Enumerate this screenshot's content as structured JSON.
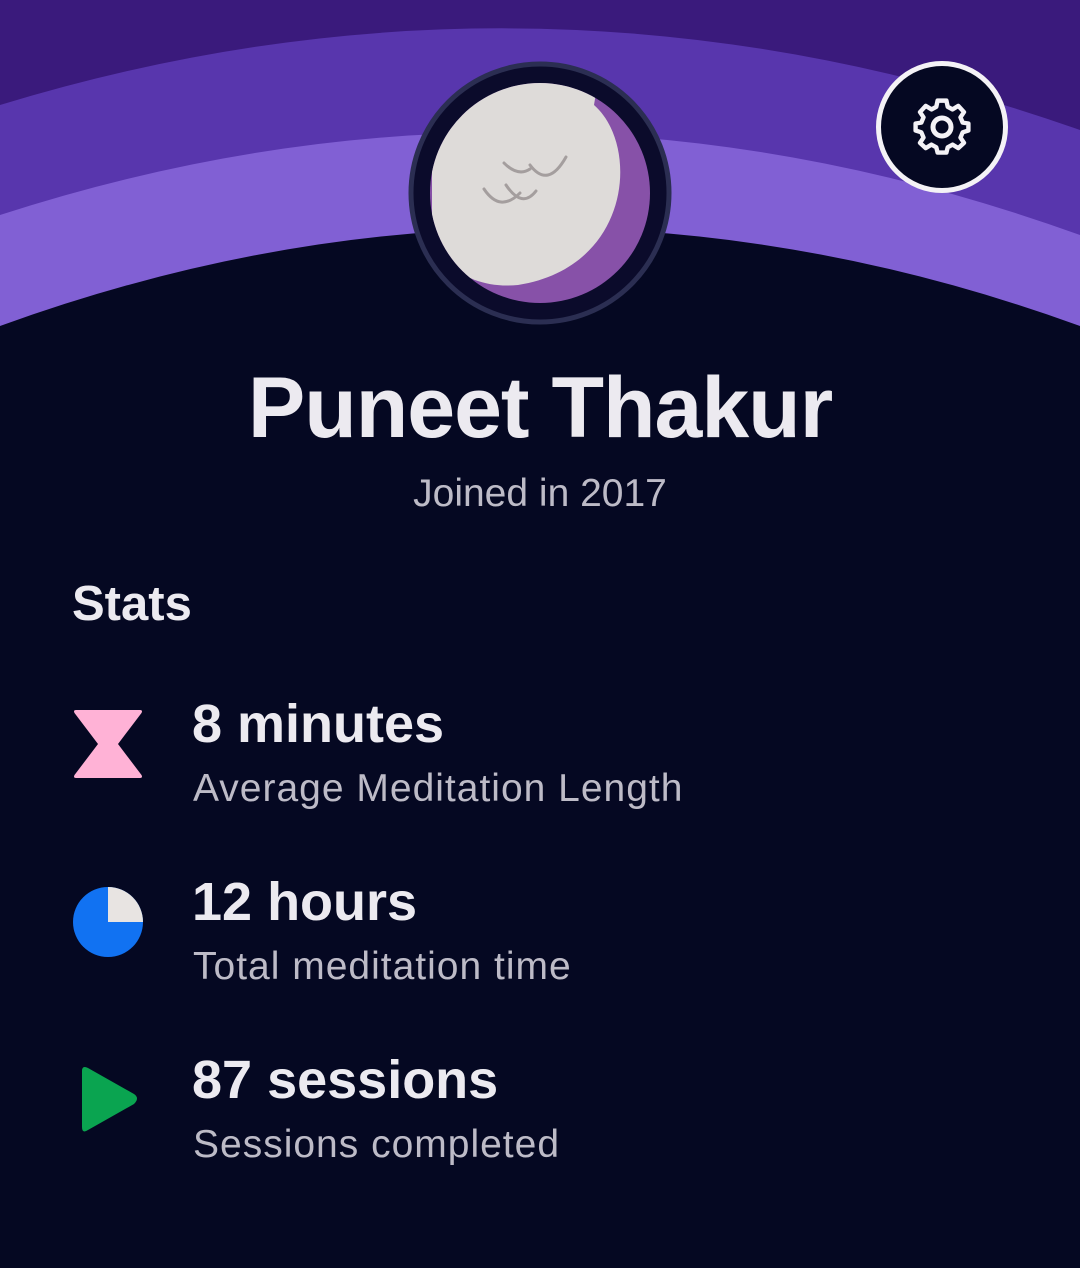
{
  "profile": {
    "name": "Puneet Thakur",
    "joined": "Joined in 2017",
    "avatar_icon": "sleeping-moon-avatar"
  },
  "header": {
    "settings_icon": "gear-icon"
  },
  "stats": {
    "heading": "Stats",
    "items": [
      {
        "value": "8 minutes",
        "label": "Average Meditation Length",
        "icon": "hourglass-icon",
        "icon_color": "#ffb2d6"
      },
      {
        "value": "12 hours",
        "label": "Total meditation time",
        "icon": "pie-clock-icon",
        "icon_color": "#1172f2"
      },
      {
        "value": "87 sessions",
        "label": "Sessions completed",
        "icon": "play-icon",
        "icon_color": "#0aa450"
      }
    ]
  },
  "colors": {
    "background": "#050822",
    "band_outer": "#3a1a7c",
    "band_middle": "#5836ad",
    "band_inner": "#8160d4",
    "avatar_moon": "#dedbd9",
    "avatar_shadow": "#8751a8"
  }
}
